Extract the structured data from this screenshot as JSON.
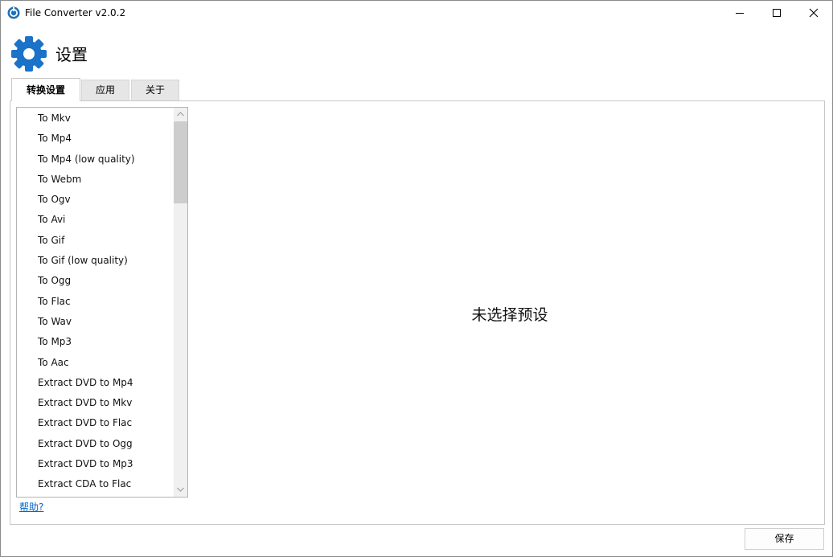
{
  "window": {
    "title": "File Converter v2.0.2",
    "accent_color": "#1a73c8"
  },
  "icons": {
    "app": "file-converter-logo-icon",
    "header": "gear-icon",
    "minimize": "minimize-icon",
    "maximize": "maximize-icon",
    "close": "close-icon",
    "scroll_up": "chevron-up-icon",
    "scroll_down": "chevron-down-icon"
  },
  "header": {
    "title": "设置"
  },
  "tabs": [
    {
      "label": "转换设置",
      "active": true
    },
    {
      "label": "应用",
      "active": false
    },
    {
      "label": "关于",
      "active": false
    }
  ],
  "presets": [
    "To Mkv",
    "To Mp4",
    "To Mp4 (low quality)",
    "To Webm",
    "To Ogv",
    "To Avi",
    "To Gif",
    "To Gif (low quality)",
    "To Ogg",
    "To Flac",
    "To Wav",
    "To Mp3",
    "To Aac",
    "Extract DVD to Mp4",
    "Extract DVD to Mkv",
    "Extract DVD to Flac",
    "Extract DVD to Ogg",
    "Extract DVD to Mp3",
    "Extract CDA to Flac"
  ],
  "help_link": "帮助?",
  "empty_message": "未选择预设",
  "save_label": "保存"
}
